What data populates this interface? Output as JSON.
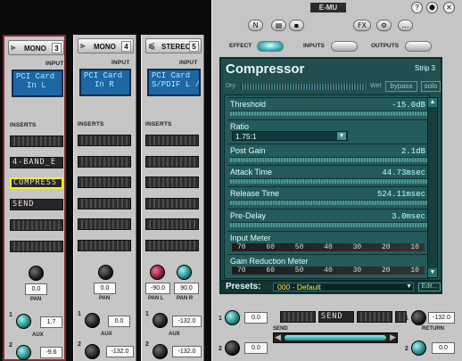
{
  "titlebar": {
    "brand": "E-MU",
    "help_icon": "?",
    "logo_icon": "⬢",
    "close_icon": "✕"
  },
  "toolbar": {
    "new_label": "N",
    "open_label": "▤",
    "save_label": "▪",
    "fx_label": "FX",
    "sync_label": "⚙",
    "more_label": "…"
  },
  "tabs": [
    "EFFECT",
    "INPUTS",
    "OUTPUTS"
  ],
  "strips": [
    {
      "kind": "MONO",
      "icon": "⫸",
      "num": "3",
      "input": [
        "PCI Card",
        "In L"
      ],
      "inserts": [
        "",
        "",
        "4-BAND_E",
        "COMPRESS",
        "SEND",
        "",
        ""
      ],
      "pan": [
        "0.0"
      ],
      "pan_label": "PAN",
      "aux": [
        [
          "1",
          "1.7"
        ],
        [
          "2",
          "-9.6"
        ]
      ]
    },
    {
      "kind": "MONO",
      "icon": "⫸",
      "num": "4",
      "input": [
        "PCI Card",
        "In R"
      ],
      "inserts": [
        "",
        "",
        "",
        "",
        "",
        "",
        ""
      ],
      "pan": [
        "0.0"
      ],
      "pan_label": "PAN",
      "aux": [
        [
          "1",
          "0.0"
        ],
        [
          "2",
          "-132.0"
        ]
      ]
    },
    {
      "kind": "STEREO",
      "icon": "⫹",
      "num": "5",
      "input": [
        "PCI Card",
        "S/PDIF L / R"
      ],
      "inserts": [
        "",
        "",
        "",
        "",
        "",
        "",
        ""
      ],
      "pan": [
        "-90.0",
        "90.0"
      ],
      "pan_labels": [
        "PAN L",
        "PAN R"
      ],
      "aux": [
        [
          "1",
          "-132.0"
        ],
        [
          "2",
          "-132.0"
        ]
      ]
    }
  ],
  "labels": {
    "input": "INPUT",
    "inserts": "INSERTS",
    "aux": "AUX"
  },
  "effect": {
    "title": "Compressor",
    "strip": "Strip 3",
    "dry": "Dry",
    "wet": "Wet",
    "bypass": "bypass",
    "solo": "solo",
    "params": [
      {
        "name": "Threshold",
        "value": "-15.0dB"
      },
      {
        "name": "Ratio",
        "value": "1.75:1",
        "dropdown": true
      },
      {
        "name": "Post Gain",
        "value": "2.1dB"
      },
      {
        "name": "Attack Time",
        "value": "44.73msec"
      },
      {
        "name": "Release Time",
        "value": "524.11msec"
      },
      {
        "name": "Pre-Delay",
        "value": "3.0msec"
      }
    ],
    "input_meter": {
      "label": "Input Meter",
      "ticks": [
        "70",
        "60",
        "50",
        "40",
        "30",
        "20",
        "10"
      ]
    },
    "gr_meter": {
      "label": "Gain Reduction Meter",
      "ticks": [
        "70",
        "60",
        "50",
        "40",
        "30",
        "20",
        "10"
      ]
    },
    "presets_label": "Presets:",
    "preset_value": "000 - Default",
    "edit_label": "Edit..."
  },
  "bottom": {
    "send_slot": "SEND",
    "send_label": "SEND",
    "return_label": "RETURN",
    "left_knobs": [
      [
        "1",
        "0.0"
      ],
      [
        "2",
        "0.0"
      ]
    ],
    "right_knobs": [
      [
        "1",
        "-132.0"
      ],
      [
        "2",
        "0.0"
      ]
    ]
  }
}
